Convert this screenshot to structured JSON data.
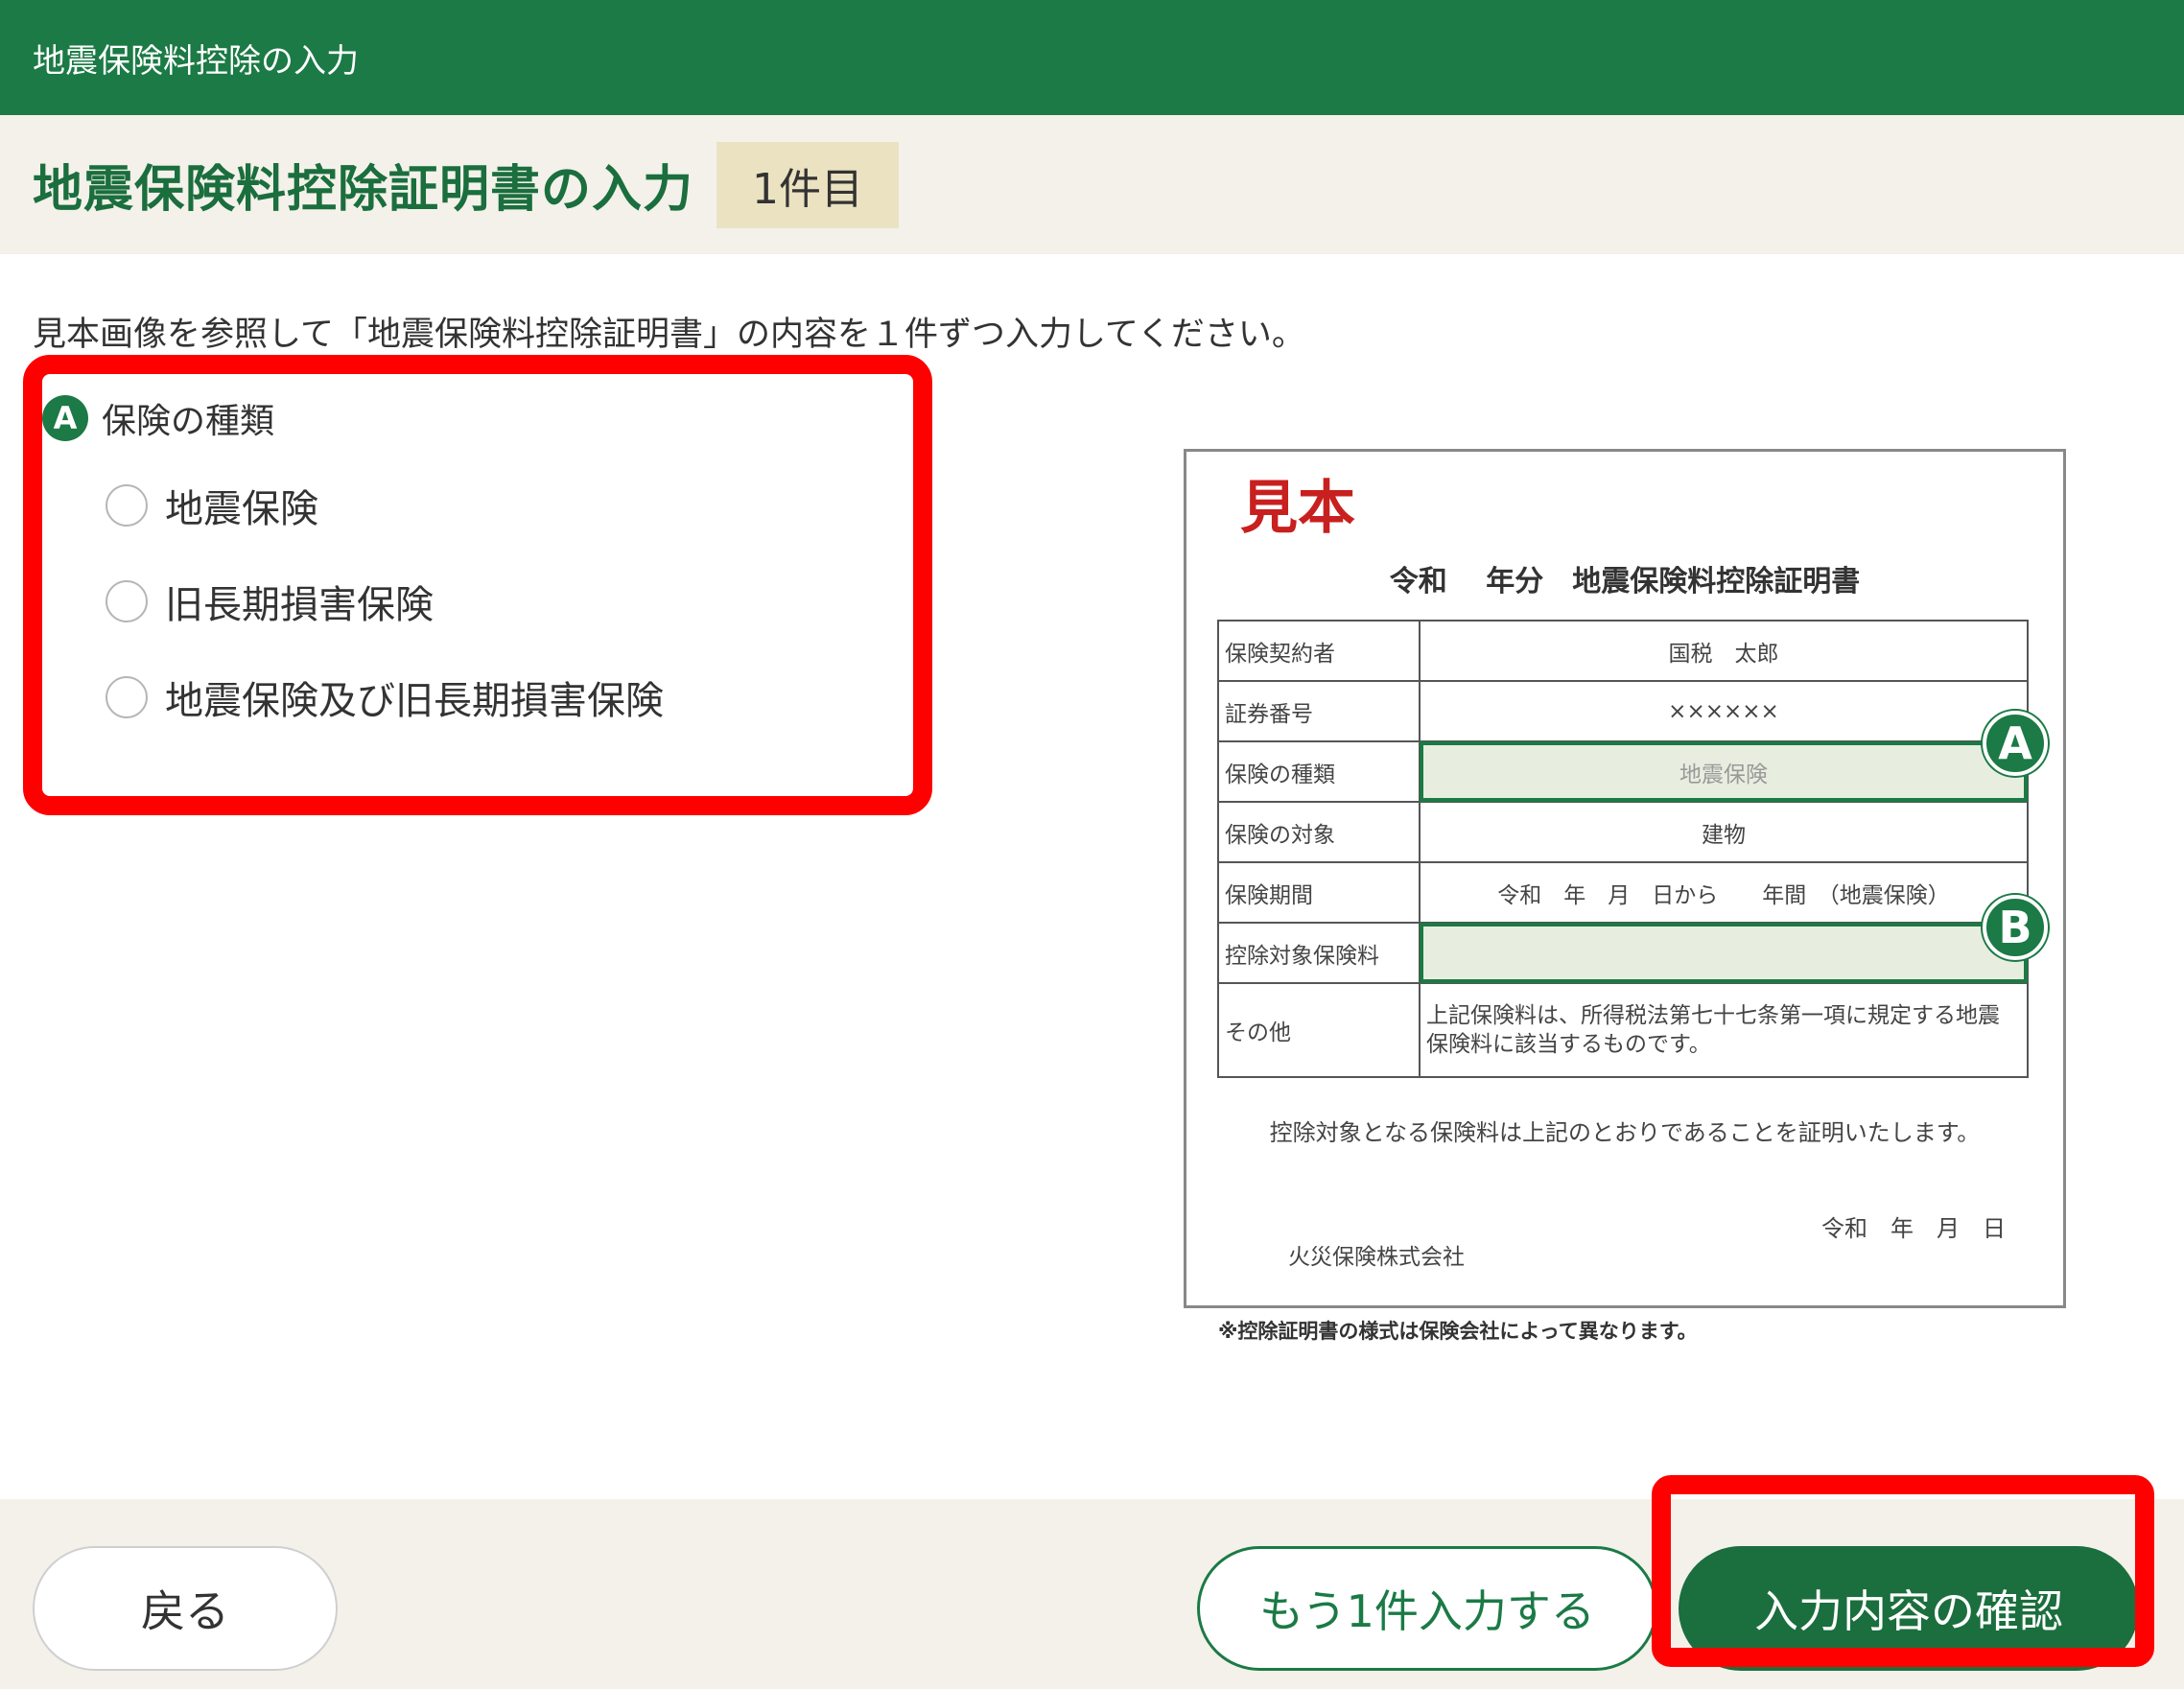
{
  "header": {
    "app_title": "地震保険料控除の入力"
  },
  "title_bar": {
    "page_title": "地震保険料控除証明書の入力",
    "count_badge": "1件目"
  },
  "main": {
    "instruction": "見本画像を参照して「地震保険料控除証明書」の内容を１件ずつ入力してください。",
    "section_marker": "A",
    "section_label": "保険の種類",
    "options": [
      "地震保険",
      "旧長期損害保険",
      "地震保険及び旧長期損害保険"
    ]
  },
  "sample": {
    "stamp": "見本",
    "title": "令和　 年分　地震保険料控除証明書",
    "rows": [
      {
        "key": "保険契約者",
        "value": "国税　太郎"
      },
      {
        "key": "証券番号",
        "value": "××××××"
      },
      {
        "key": "保険の種類",
        "value": "地震保険"
      },
      {
        "key": "保険の対象",
        "value": "建物"
      },
      {
        "key": "保険期間",
        "value": "令和　年　月　日から　　年間　（地震保険）"
      },
      {
        "key": "控除対象保険料",
        "value": ""
      },
      {
        "key": "その他",
        "value": "上記保険料は、所得税法第七十七条第一項に規定する地震保険料に該当するものです。"
      }
    ],
    "marker_a": "A",
    "marker_b": "B",
    "statement": "控除対象となる保険料は上記のとおりであることを証明いたします。",
    "date": "令和　年　月　日",
    "company": "火災保険株式会社",
    "note": "※控除証明書の様式は保険会社によって異なります。"
  },
  "footer": {
    "back_label": "戻る",
    "another_label": "もう1件入力する",
    "confirm_label": "入力内容の確認"
  },
  "colors": {
    "brand_green": "#1b7a45",
    "title_green": "#1b6e3d",
    "highlight_red": "#ff0000",
    "badge_bg": "#ebe2c2",
    "panel_bg": "#f3f1ea"
  }
}
